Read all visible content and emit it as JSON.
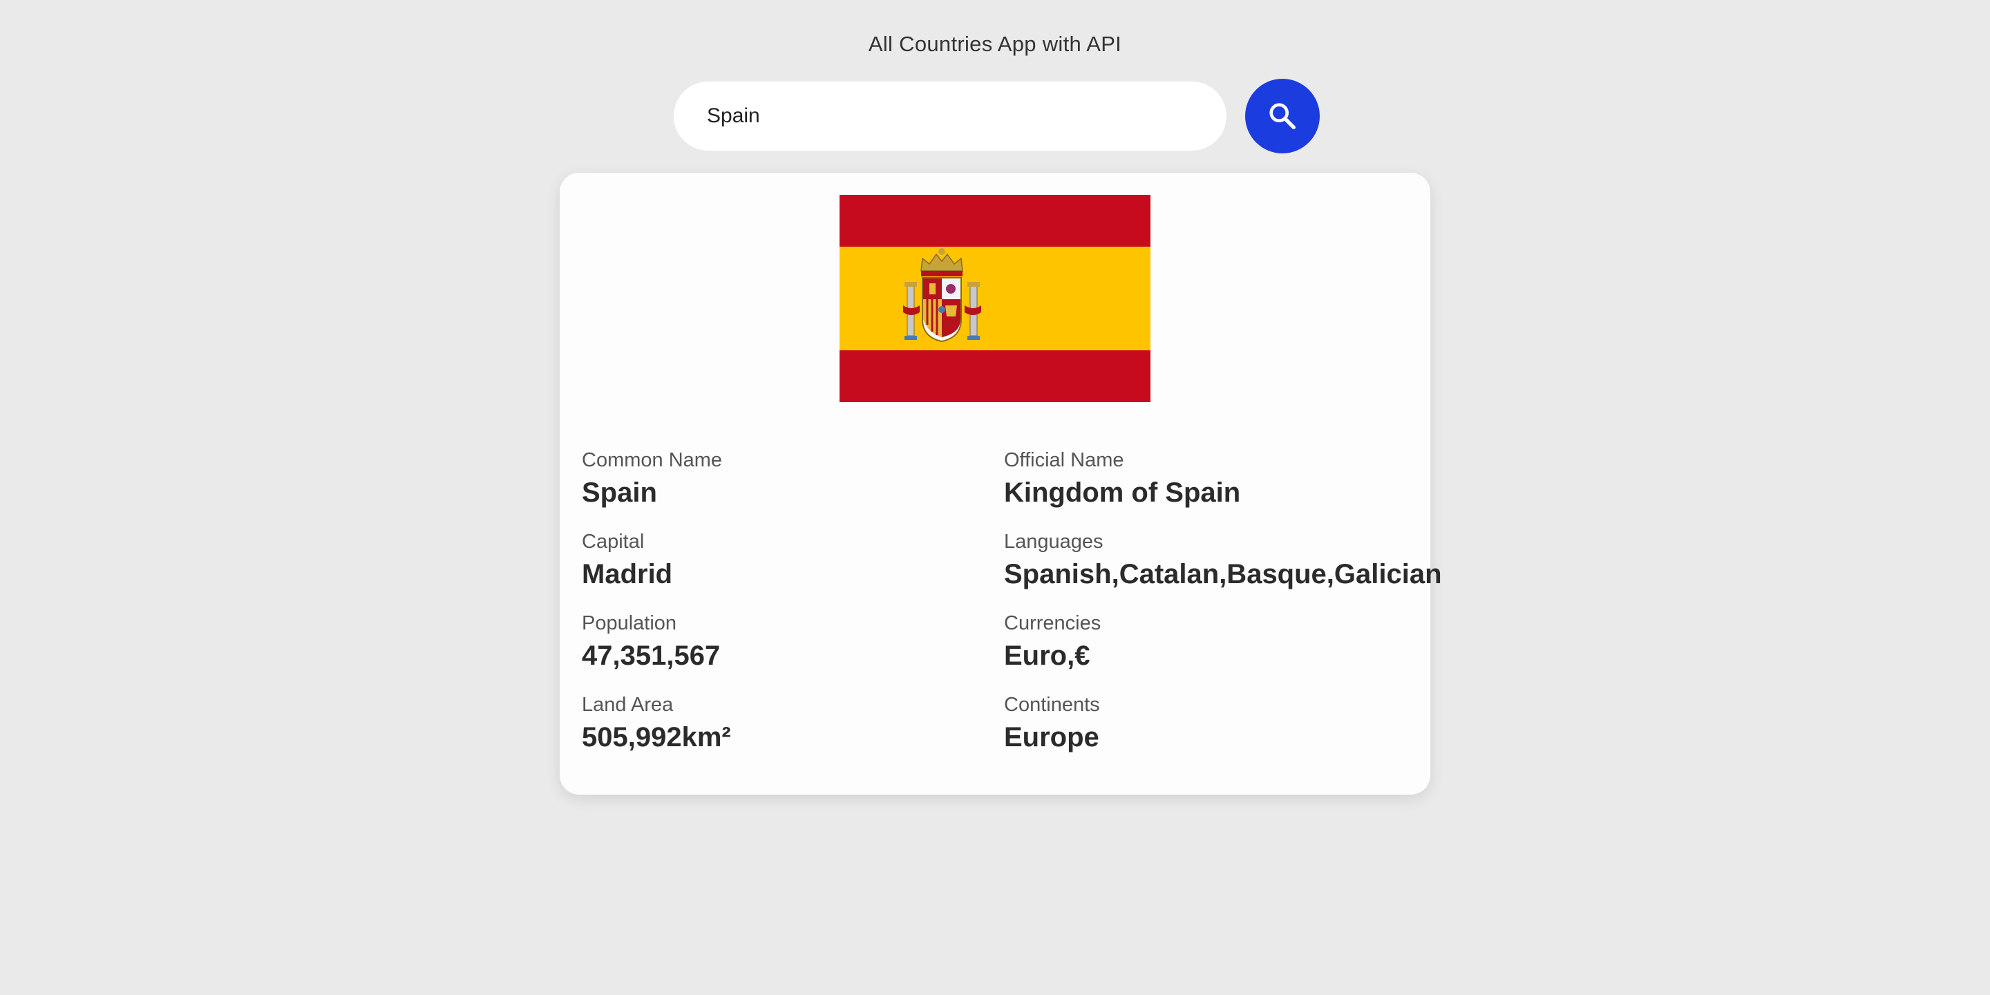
{
  "app": {
    "title": "All Countries App with API"
  },
  "search": {
    "value": "Spain",
    "button_icon": "search-icon"
  },
  "country": {
    "flag_icon": "spain-flag",
    "colors": {
      "red": "#c60b1e",
      "yellow": "#ffc400"
    },
    "fields": [
      {
        "label": "Common Name",
        "value": "Spain"
      },
      {
        "label": "Official Name",
        "value": "Kingdom of Spain"
      },
      {
        "label": "Capital",
        "value": "Madrid"
      },
      {
        "label": "Languages",
        "value": "Spanish,Catalan,Basque,Galician"
      },
      {
        "label": "Population",
        "value": "47,351,567"
      },
      {
        "label": "Currencies",
        "value": "Euro,€"
      },
      {
        "label": "Land Area",
        "value": "505,992km²"
      },
      {
        "label": "Continents",
        "value": "Europe"
      }
    ]
  },
  "theme": {
    "background": "#eaeaea",
    "accent": "#1b3de0"
  }
}
